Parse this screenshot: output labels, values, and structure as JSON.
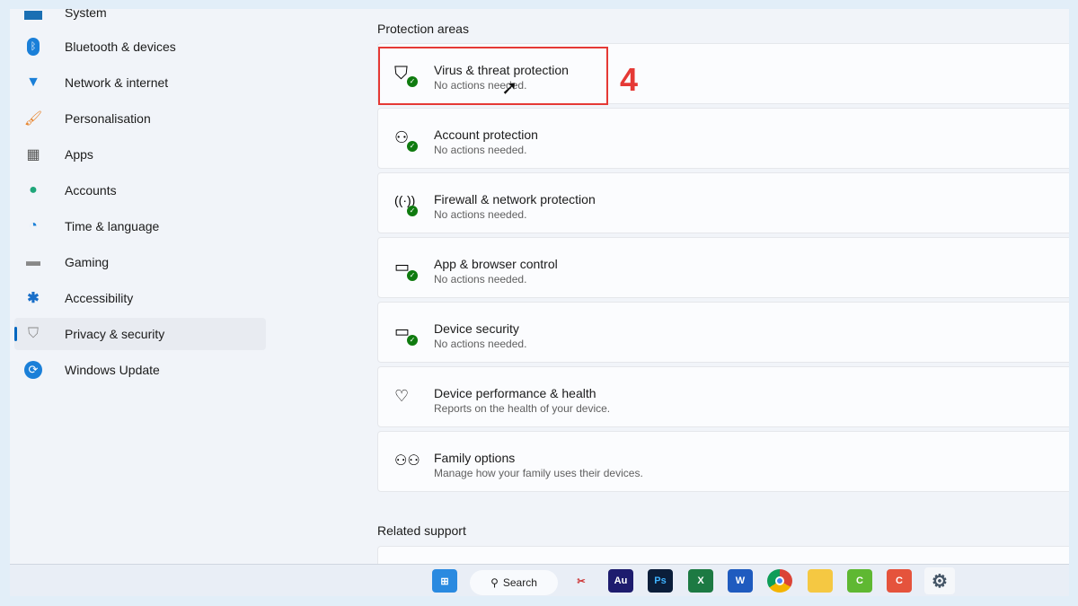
{
  "sidebar": {
    "items": [
      {
        "label": "System",
        "icon": "system-icon"
      },
      {
        "label": "Bluetooth & devices",
        "icon": "bluetooth-icon"
      },
      {
        "label": "Network & internet",
        "icon": "wifi-icon"
      },
      {
        "label": "Personalisation",
        "icon": "brush-icon"
      },
      {
        "label": "Apps",
        "icon": "apps-icon"
      },
      {
        "label": "Accounts",
        "icon": "account-icon"
      },
      {
        "label": "Time & language",
        "icon": "clock-globe-icon"
      },
      {
        "label": "Gaming",
        "icon": "gamepad-icon"
      },
      {
        "label": "Accessibility",
        "icon": "accessibility-icon"
      },
      {
        "label": "Privacy & security",
        "icon": "shield-icon",
        "selected": true
      },
      {
        "label": "Windows Update",
        "icon": "update-icon"
      }
    ]
  },
  "main": {
    "section_title": "Protection areas",
    "related_title": "Related support",
    "cards": [
      {
        "title": "Virus & threat protection",
        "subtitle": "No actions needed.",
        "icon": "virus-shield-icon"
      },
      {
        "title": "Account protection",
        "subtitle": "No actions needed.",
        "icon": "account-protection-icon"
      },
      {
        "title": "Firewall & network protection",
        "subtitle": "No actions needed.",
        "icon": "firewall-icon"
      },
      {
        "title": "App & browser control",
        "subtitle": "No actions needed.",
        "icon": "app-browser-icon"
      },
      {
        "title": "Device security",
        "subtitle": "No actions needed.",
        "icon": "device-security-icon"
      },
      {
        "title": "Device performance & health",
        "subtitle": "Reports on the health of your device.",
        "icon": "heart-icon"
      },
      {
        "title": "Family options",
        "subtitle": "Manage how your family uses their devices.",
        "icon": "family-icon"
      }
    ]
  },
  "annotation": {
    "step": "4",
    "color": "#e53935"
  },
  "taskbar": {
    "search_label": "Search",
    "apps": [
      {
        "label": "",
        "name": "snipping-tool"
      },
      {
        "label": "Au",
        "name": "audition"
      },
      {
        "label": "Ps",
        "name": "photoshop"
      },
      {
        "label": "X",
        "name": "excel"
      },
      {
        "label": "W",
        "name": "word"
      },
      {
        "label": "",
        "name": "chrome"
      },
      {
        "label": "",
        "name": "file-explorer"
      },
      {
        "label": "C",
        "name": "camtasia"
      },
      {
        "label": "C",
        "name": "camtasia-recorder"
      },
      {
        "label": "",
        "name": "settings"
      }
    ]
  }
}
